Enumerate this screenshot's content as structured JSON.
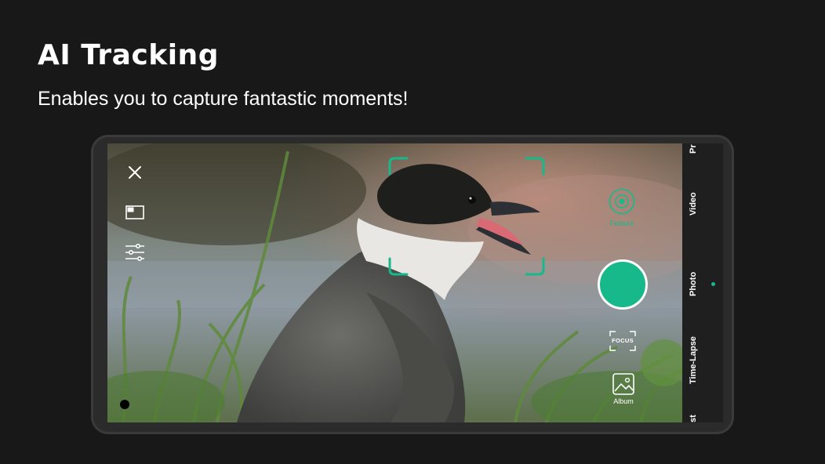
{
  "promo": {
    "title": "AI Tracking",
    "subtitle": "Enables you to capture fantastic moments!"
  },
  "camera": {
    "modes": [
      "Pr",
      "Video",
      "Photo",
      "Time-Lapse",
      "st"
    ],
    "active_mode": "Photo",
    "feature_label": "Feature",
    "focus_label": "FOCUS",
    "album_label": "Album",
    "accent_color": "#17b98a"
  }
}
